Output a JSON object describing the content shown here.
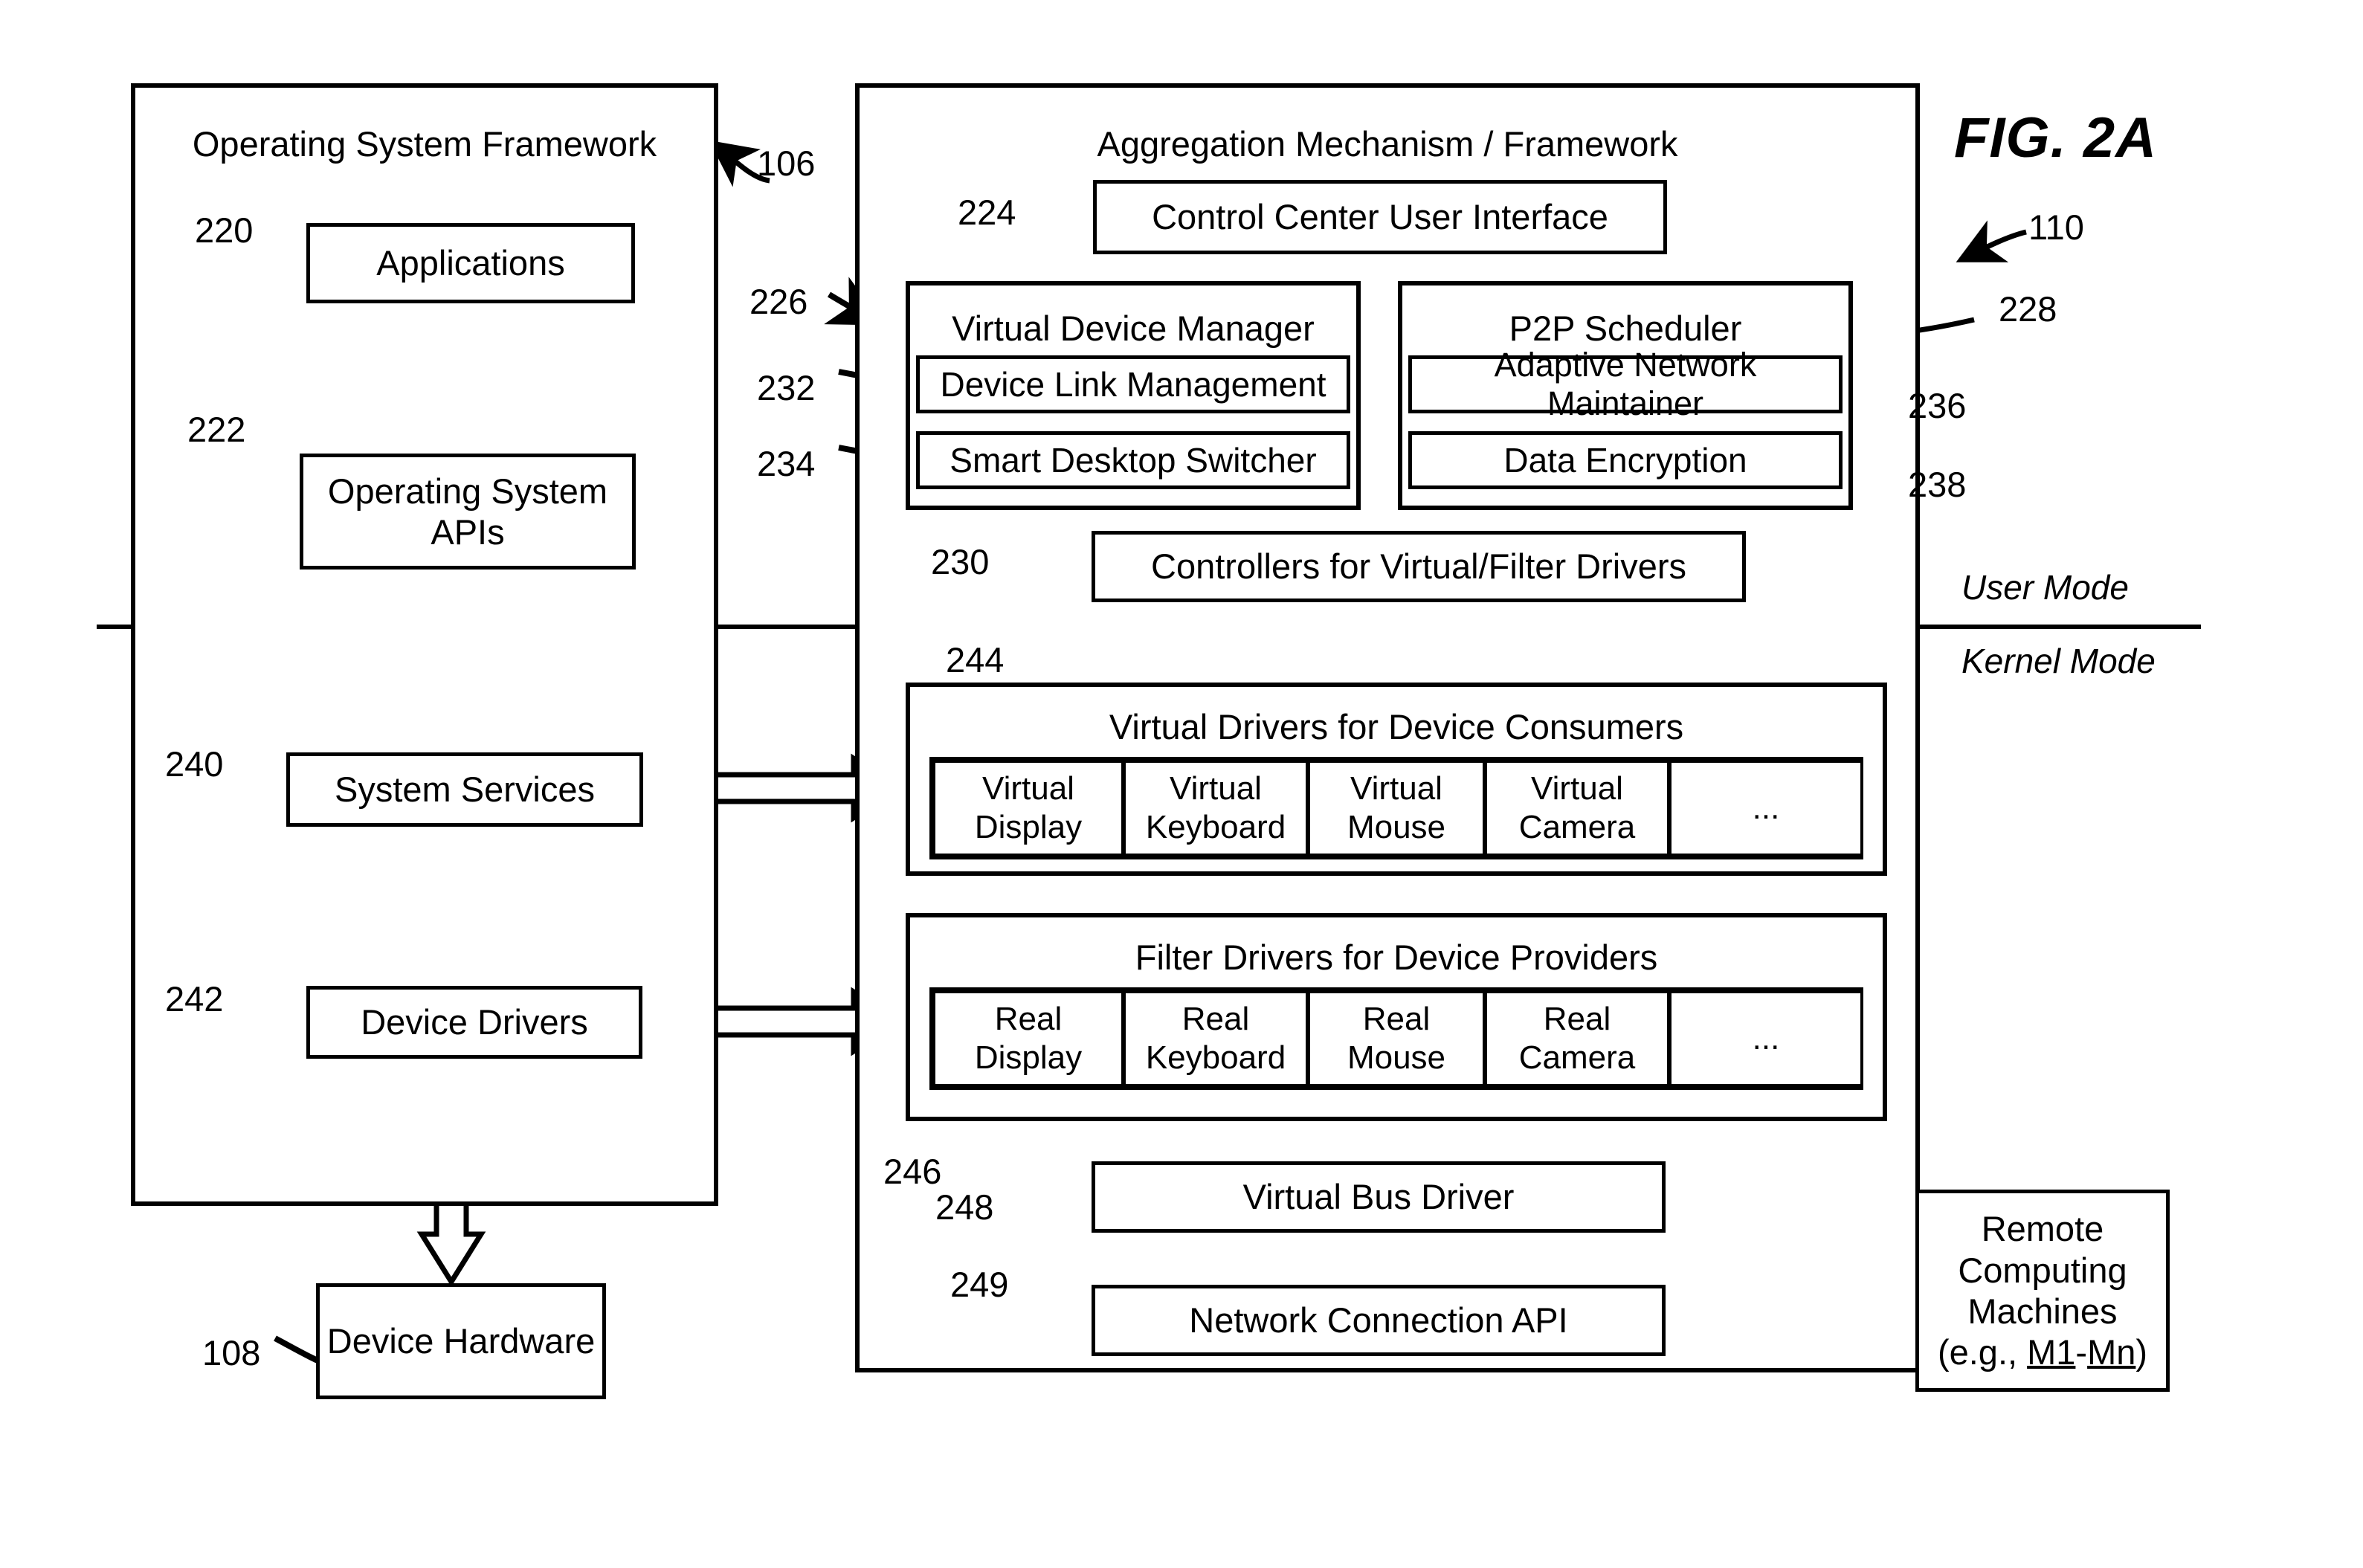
{
  "figure": {
    "title": "FIG. 2A"
  },
  "mode_labels": {
    "user": "User Mode",
    "kernel": "Kernel Mode"
  },
  "os_framework": {
    "title": "Operating System Framework",
    "ref": "106",
    "applications": {
      "label": "Applications",
      "ref": "220"
    },
    "os_apis": {
      "label": "Operating System APIs",
      "ref": "222"
    },
    "system_services": {
      "label": "System Services",
      "ref": "240"
    },
    "device_drivers": {
      "label": "Device Drivers",
      "ref": "242"
    }
  },
  "device_hardware": {
    "label": "Device Hardware",
    "ref": "108"
  },
  "aggregation": {
    "title": "Aggregation Mechanism / Framework",
    "ref": "110",
    "control_center": {
      "label": "Control Center User Interface",
      "ref": "224"
    },
    "virtual_device_manager": {
      "label": "Virtual Device Manager",
      "ref": "226",
      "children": [
        {
          "label": "Device Link Management",
          "ref": "232"
        },
        {
          "label": "Smart Desktop Switcher",
          "ref": "234"
        }
      ]
    },
    "p2p_scheduler": {
      "label": "P2P Scheduler",
      "ref": "228",
      "children": [
        {
          "label": "Adaptive Network Maintainer",
          "ref": "236"
        },
        {
          "label": "Data Encryption",
          "ref": "238"
        }
      ]
    },
    "controllers": {
      "label": "Controllers for Virtual/Filter Drivers",
      "ref": "230"
    },
    "virtual_drivers": {
      "label": "Virtual Drivers for Device Consumers",
      "ref": "244",
      "cells": [
        {
          "line1": "Virtual",
          "line2": "Display"
        },
        {
          "line1": "Virtual",
          "line2": "Keyboard"
        },
        {
          "line1": "Virtual",
          "line2": "Mouse"
        },
        {
          "line1": "Virtual",
          "line2": "Camera"
        },
        {
          "line1": "",
          "line2": "..."
        }
      ]
    },
    "filter_drivers": {
      "label": "Filter Drivers for Device Providers",
      "ref": "246",
      "cells": [
        {
          "line1": "Real",
          "line2": "Display"
        },
        {
          "line1": "Real",
          "line2": "Keyboard"
        },
        {
          "line1": "Real",
          "line2": "Mouse"
        },
        {
          "line1": "Real",
          "line2": "Camera"
        },
        {
          "line1": "",
          "line2": "..."
        }
      ]
    },
    "virtual_bus_driver": {
      "label": "Virtual Bus Driver",
      "ref": "248"
    },
    "network_connection_api": {
      "label": "Network Connection API",
      "ref": "249"
    }
  },
  "remote_machines": {
    "line1": "Remote",
    "line2": "Computing",
    "line3": "Machines",
    "line4_prefix": "(e.g., ",
    "line4_m1": "M1",
    "line4_dash": "-",
    "line4_mn": "Mn",
    "line4_suffix": ")"
  }
}
